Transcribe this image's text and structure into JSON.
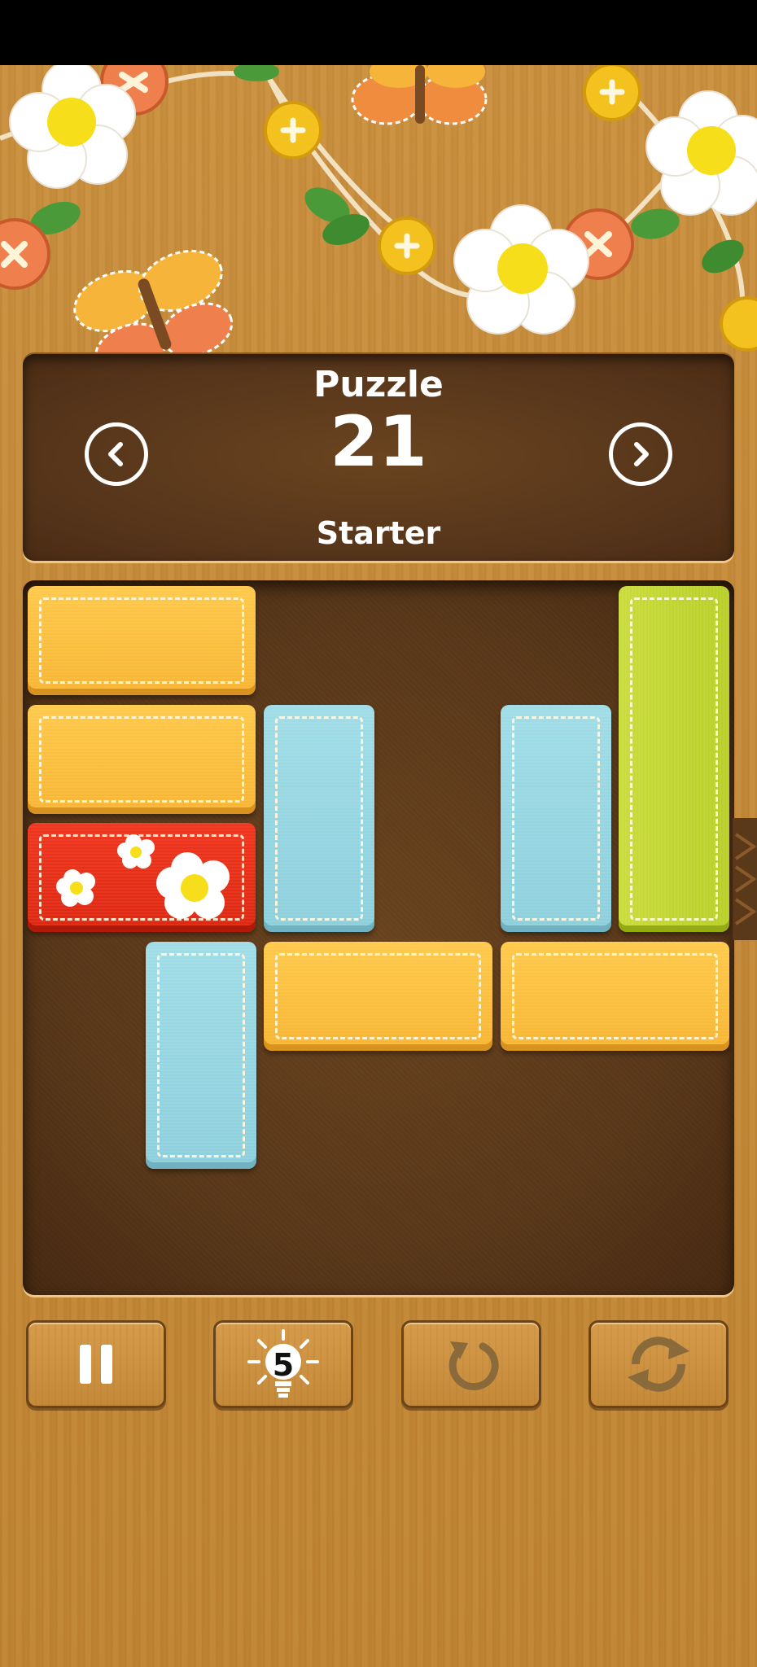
{
  "header": {
    "title": "Puzzle",
    "puzzle_number": "21",
    "difficulty": "Starter",
    "prev_icon": "chevron-left-icon",
    "next_icon": "chevron-right-icon"
  },
  "board": {
    "grid_size": 6,
    "blocks": [
      {
        "name": "block-yellow-h-1",
        "color": "yellow",
        "orientation": "horizontal",
        "length": 2
      },
      {
        "name": "block-yellow-h-2",
        "color": "yellow",
        "orientation": "horizontal",
        "length": 2
      },
      {
        "name": "block-target-red",
        "color": "red",
        "orientation": "horizontal",
        "length": 2
      },
      {
        "name": "block-blue-v-1",
        "color": "blue",
        "orientation": "vertical",
        "length": 2
      },
      {
        "name": "block-blue-v-2",
        "color": "blue",
        "orientation": "vertical",
        "length": 2
      },
      {
        "name": "block-green-v",
        "color": "green",
        "orientation": "vertical",
        "length": 3
      },
      {
        "name": "block-blue-v-3",
        "color": "blue",
        "orientation": "vertical",
        "length": 2
      },
      {
        "name": "block-yellow-h-3",
        "color": "yellow",
        "orientation": "horizontal",
        "length": 2
      },
      {
        "name": "block-yellow-h-4",
        "color": "yellow",
        "orientation": "horizontal",
        "length": 2
      }
    ]
  },
  "toolbar": {
    "pause_icon": "pause-icon",
    "hint_icon": "lightbulb-icon",
    "hint_count": "5",
    "undo_icon": "undo-icon",
    "restart_icon": "restart-icon"
  },
  "colors": {
    "yellow": "#f7b532",
    "blue": "#8ccfdc",
    "green": "#b7cf26",
    "red": "#dd2710",
    "board": "#5a381a",
    "wood": "#c48a3a"
  }
}
